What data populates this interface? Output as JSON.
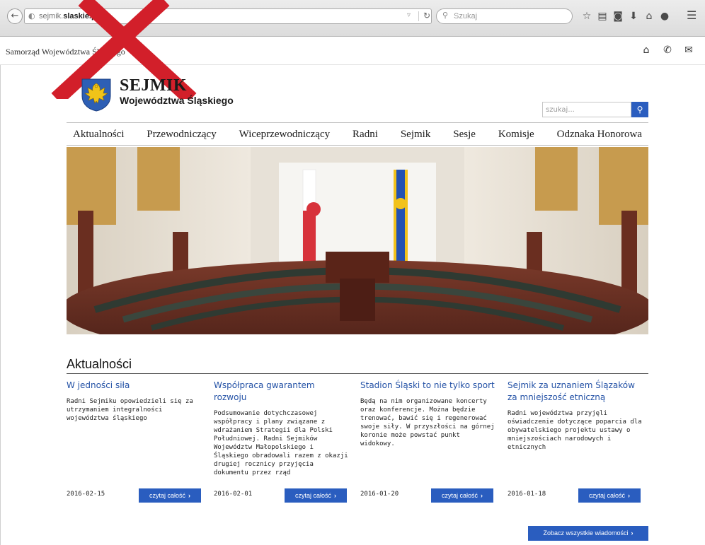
{
  "browser": {
    "back_glyph": "←",
    "url_prefix": "sejmik.",
    "url_domain": "slaskie.pl",
    "search_placeholder": "Szukaj",
    "icons": [
      "star-icon",
      "bookmarks-icon",
      "pocket-icon",
      "download-icon",
      "home-icon",
      "chat-icon",
      "menu-icon"
    ]
  },
  "portal": {
    "title": "Samorząd Województwa Śląskiego",
    "icons": [
      "home-icon",
      "phone-icon",
      "mail-icon"
    ]
  },
  "site": {
    "logo_title": "SEJMIK",
    "logo_subtitle": "Województwa Śląskiego",
    "search_placeholder": "szukaj..."
  },
  "nav": {
    "items": [
      "Aktualności",
      "Przewodniczący",
      "Wiceprzewodniczący",
      "Radni",
      "Sejmik",
      "Sesje",
      "Komisje",
      "Odznaka Honorowa"
    ]
  },
  "colors": {
    "accent": "#2a5dbf",
    "link": "#2452a6",
    "overlay_x": "#d21f2a"
  },
  "news": {
    "heading": "Aktualności",
    "read_more_label": "czytaj całość",
    "all_news_label": "Zobacz wszystkie wiadomości",
    "items": [
      {
        "title": "W jedności siła",
        "text": "Radni Sejmiku opowiedzieli się za utrzymaniem integralności województwa śląskiego",
        "date": "2016-02-15"
      },
      {
        "title": "Współpraca gwarantem rozwoju",
        "text": "Podsumowanie dotychczasowej współpracy i plany związane z wdrażaniem Strategii dla Polski Południowej. Radni Sejmików Województw Małopolskiego i Śląskiego obradowali razem z okazji drugiej rocznicy przyjęcia dokumentu przez rząd",
        "date": "2016-02-01"
      },
      {
        "title": "Stadion Śląski to nie tylko sport",
        "text": "Będą na nim organizowane koncerty oraz konferencje. Można będzie trenować, bawić się i regenerować swoje siły. W przyszłości na górnej koronie może powstać punkt widokowy.",
        "date": "2016-01-20"
      },
      {
        "title": "Sejmik za uznaniem Ślązaków za mniejszość etniczną",
        "text": "Radni województwa przyjęli oświadczenie dotyczące poparcia dla obywatelskiego projektu ustawy o mniejszościach narodowych i etnicznych",
        "date": "2016-01-18"
      }
    ]
  }
}
